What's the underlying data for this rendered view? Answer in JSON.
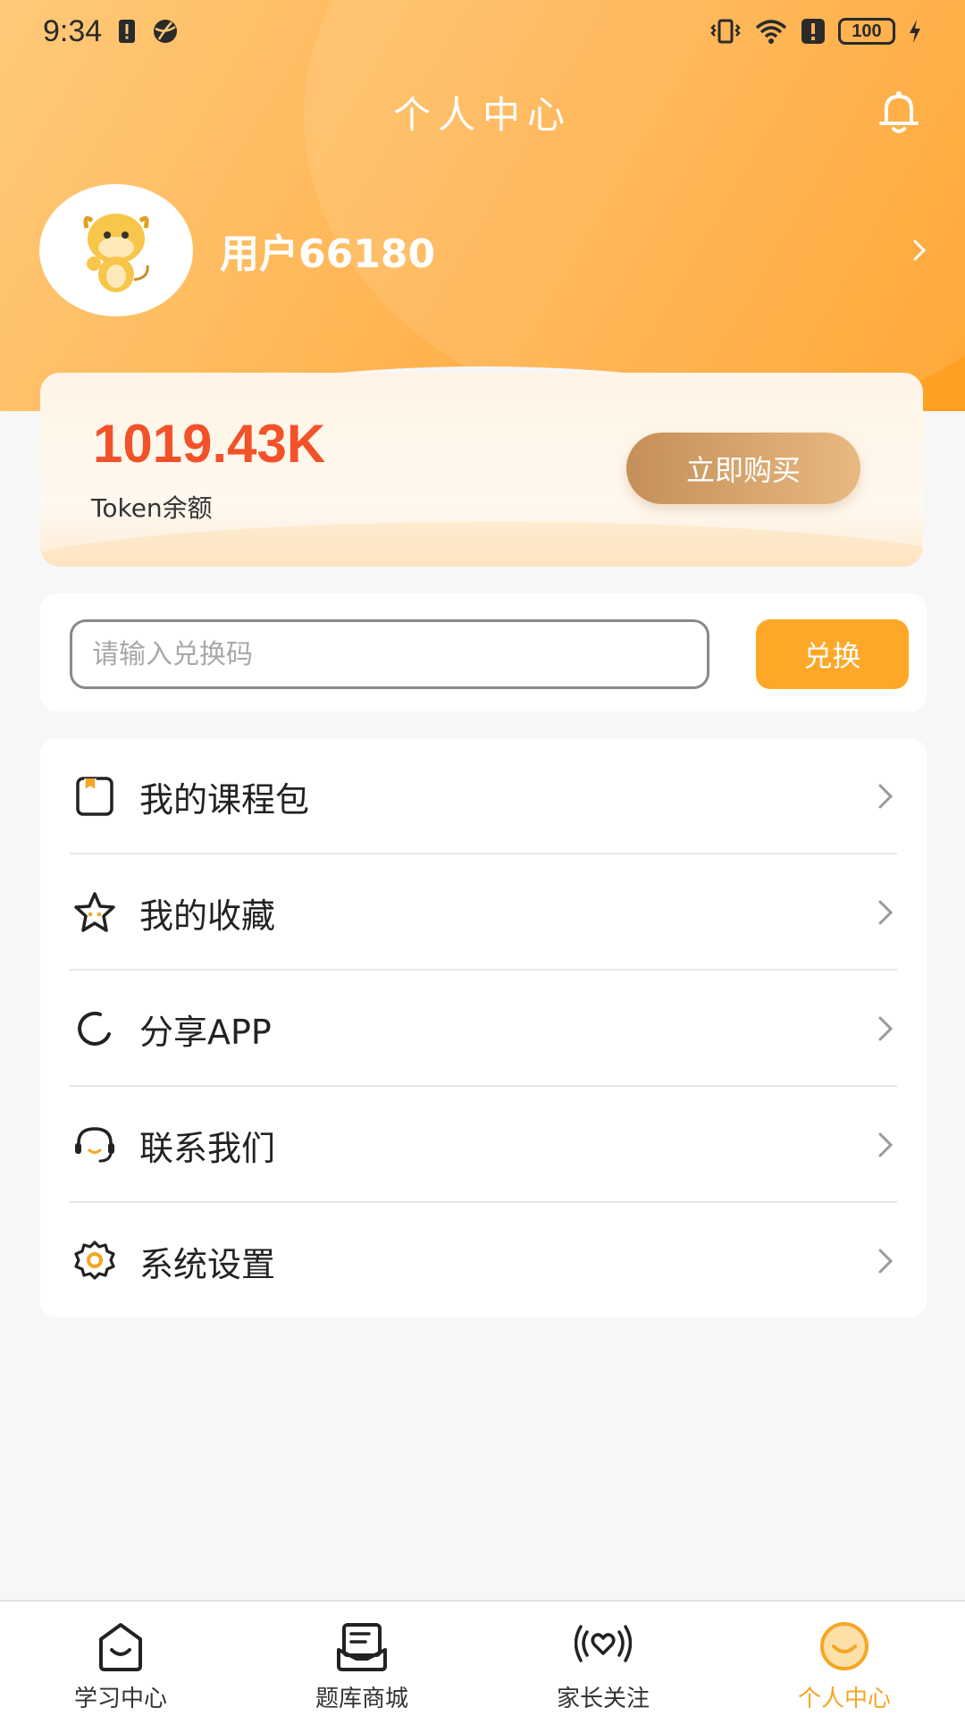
{
  "status_bar": {
    "time": "9:34",
    "battery": "100"
  },
  "header": {
    "title": "个人中心"
  },
  "profile": {
    "username": "用户66180"
  },
  "token": {
    "value": "1019.43K",
    "label": "Token余额",
    "buy_label": "立即购买"
  },
  "redeem": {
    "placeholder": "请输入兑换码",
    "value": "",
    "button_label": "兑换"
  },
  "menu": {
    "items": [
      {
        "label": "我的课程包",
        "icon": "course-package-icon"
      },
      {
        "label": "我的收藏",
        "icon": "star-icon"
      },
      {
        "label": "分享APP",
        "icon": "share-icon"
      },
      {
        "label": "联系我们",
        "icon": "headset-icon"
      },
      {
        "label": "系统设置",
        "icon": "gear-icon"
      }
    ]
  },
  "tabs": [
    {
      "label": "学习中心",
      "icon": "study-icon",
      "active": false
    },
    {
      "label": "题库商城",
      "icon": "question-bank-icon",
      "active": false
    },
    {
      "label": "家长关注",
      "icon": "parent-care-icon",
      "active": false
    },
    {
      "label": "个人中心",
      "icon": "profile-smile-icon",
      "active": true
    }
  ],
  "colors": {
    "accent": "#ffa726",
    "token_value": "#f2522a",
    "active_tab": "#f5a623",
    "header_gradient_start": "#ffc979",
    "header_gradient_end": "#ff9f21"
  }
}
